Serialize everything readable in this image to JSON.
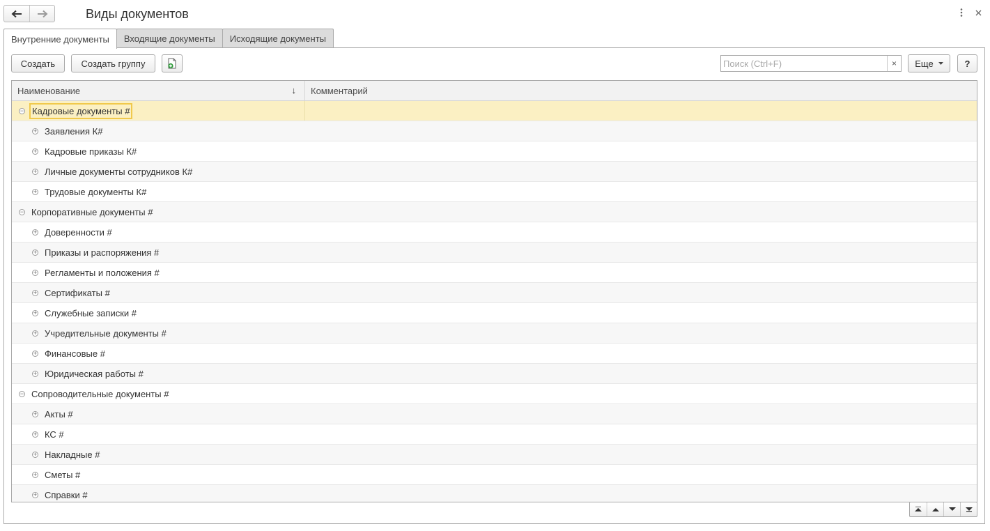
{
  "header": {
    "title": "Виды документов",
    "back_icon": "arrow-left-icon",
    "forward_icon": "arrow-right-icon",
    "more_icon": "more-vertical-icon",
    "close_icon": "close-icon"
  },
  "tabs": [
    {
      "label": "Внутренние документы",
      "active": true
    },
    {
      "label": "Входящие документы",
      "active": false
    },
    {
      "label": "Исходящие документы",
      "active": false
    }
  ],
  "toolbar": {
    "create_label": "Создать",
    "create_group_label": "Создать группу",
    "create_file_icon": "add-document-icon",
    "search_placeholder": "Поиск (Ctrl+F)",
    "search_clear": "×",
    "more_label": "Еще",
    "help_label": "?"
  },
  "table": {
    "columns": {
      "name": "Наименование",
      "comment": "Комментарий"
    },
    "sort_arrow": "↓",
    "rows": [
      {
        "level": 0,
        "expanded": true,
        "label": "Кадровые документы #",
        "comment": "",
        "selected": true
      },
      {
        "level": 1,
        "expanded": false,
        "label": "Заявления К#",
        "comment": ""
      },
      {
        "level": 1,
        "expanded": false,
        "label": "Кадровые приказы К#",
        "comment": ""
      },
      {
        "level": 1,
        "expanded": false,
        "label": "Личные документы сотрудников К#",
        "comment": ""
      },
      {
        "level": 1,
        "expanded": false,
        "label": "Трудовые документы К#",
        "comment": ""
      },
      {
        "level": 0,
        "expanded": true,
        "label": "Корпоративные документы #",
        "comment": ""
      },
      {
        "level": 1,
        "expanded": false,
        "label": "Доверенности #",
        "comment": ""
      },
      {
        "level": 1,
        "expanded": false,
        "label": "Приказы и распоряжения #",
        "comment": ""
      },
      {
        "level": 1,
        "expanded": false,
        "label": "Регламенты и положения #",
        "comment": ""
      },
      {
        "level": 1,
        "expanded": false,
        "label": "Сертификаты #",
        "comment": ""
      },
      {
        "level": 1,
        "expanded": false,
        "label": "Служебные записки #",
        "comment": ""
      },
      {
        "level": 1,
        "expanded": false,
        "label": "Учредительные документы #",
        "comment": ""
      },
      {
        "level": 1,
        "expanded": false,
        "label": "Финансовые #",
        "comment": ""
      },
      {
        "level": 1,
        "expanded": false,
        "label": "Юридическая работы #",
        "comment": ""
      },
      {
        "level": 0,
        "expanded": true,
        "label": "Сопроводительные документы #",
        "comment": ""
      },
      {
        "level": 1,
        "expanded": false,
        "label": "Акты #",
        "comment": ""
      },
      {
        "level": 1,
        "expanded": false,
        "label": "КС #",
        "comment": ""
      },
      {
        "level": 1,
        "expanded": false,
        "label": "Накладные #",
        "comment": ""
      },
      {
        "level": 1,
        "expanded": false,
        "label": "Сметы #",
        "comment": ""
      },
      {
        "level": 1,
        "expanded": false,
        "label": "Справки #",
        "comment": ""
      }
    ]
  },
  "pager": {
    "first_icon": "scroll-to-top-icon",
    "up_icon": "scroll-up-icon",
    "down_icon": "scroll-down-icon",
    "last_icon": "scroll-to-bottom-icon"
  },
  "colors": {
    "selected_row": "#fbf0c3",
    "selected_border": "#f0c94c",
    "icon_green": "#2e9a3a"
  }
}
